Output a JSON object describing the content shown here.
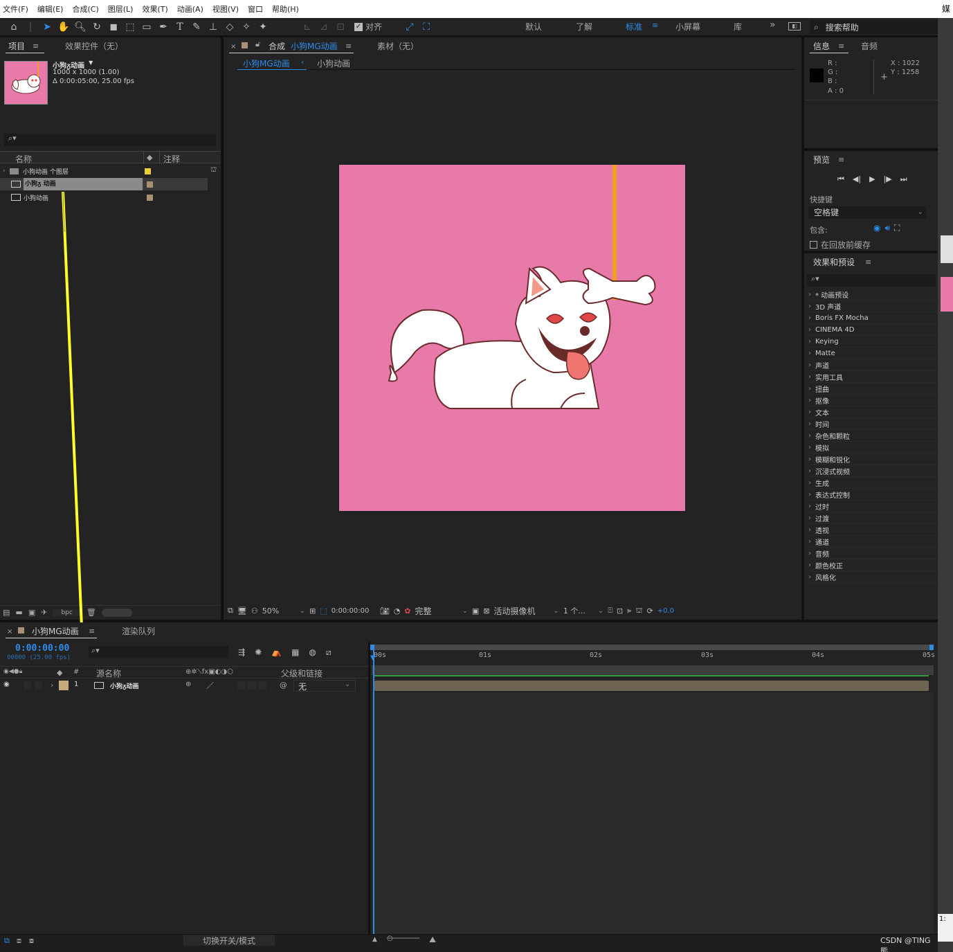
{
  "menu": [
    "文件(F)",
    "编辑(E)",
    "合成(C)",
    "图层(L)",
    "效果(T)",
    "动画(A)",
    "视图(V)",
    "窗口",
    "帮助(H)"
  ],
  "ext_top": "媒",
  "toolbar": {
    "align_label": "对齐",
    "workspaces": [
      "默认",
      "了解",
      "标准",
      "小屏幕",
      "库"
    ],
    "active_workspace": "标准",
    "more": "»",
    "search_help": "搜索帮助"
  },
  "project": {
    "tab": "项目",
    "effects_tab": "效果控件（无）",
    "selected_name": "小狗ᵹ动画",
    "dimensions": "1000 x 1000 (1.00)",
    "duration": "Δ 0:00:05:00, 25.00 fps",
    "col_name": "名称",
    "col_comment": "注释",
    "items": [
      {
        "name": "小狗动画 个图层",
        "type": "folder",
        "color": "#e8d03a"
      },
      {
        "name": "小狗ᵹ 动画",
        "type": "comp",
        "color": "#a89172",
        "selected": true
      },
      {
        "name": "小狗动画",
        "type": "comp",
        "color": "#a89172"
      }
    ],
    "bpc": "bpc"
  },
  "composition": {
    "tab_prefix": "合成",
    "tab_name": "小狗MG动画",
    "footage_tab": "素材（无）",
    "breadcrumb_active": "小狗MG动画",
    "breadcrumb_next": "小狗动画",
    "zoom": "50%",
    "timecode": "0:00:00:00",
    "resolution": "完整",
    "camera": "活动摄像机",
    "views": "1 个...",
    "exposure": "+0.0",
    "canvas_color": "#e77aa9"
  },
  "info": {
    "tab": "信息",
    "audio_tab": "音频",
    "r": "R :",
    "g": "G :",
    "b": "B :",
    "a": "A : 0",
    "x": "X : 1022",
    "y": "Y : 1258"
  },
  "preview": {
    "tab": "预览",
    "shortcut_label": "快捷键",
    "shortcut_value": "空格键",
    "include_label": "包含:",
    "cache_label": "在回放前缓存"
  },
  "effects": {
    "tab": "效果和预设",
    "items": [
      "* 动画预设",
      "3D 声道",
      "Boris FX Mocha",
      "CINEMA 4D",
      "Keying",
      "Matte",
      "声道",
      "实用工具",
      "扭曲",
      "抠像",
      "文本",
      "时间",
      "杂色和颗粒",
      "模拟",
      "模糊和锐化",
      "沉浸式视频",
      "生成",
      "表达式控制",
      "过时",
      "过渡",
      "透视",
      "通道",
      "音频",
      "颜色校正",
      "风格化"
    ]
  },
  "timeline": {
    "tab": "小狗MG动画",
    "render_tab": "渲染队列",
    "timecode": "0:00:00:00",
    "frames": "00000 (25.00 fps)",
    "col_num": "#",
    "col_source": "源名称",
    "col_parent": "父级和链接",
    "layer": {
      "num": "1",
      "name": "小狗ᵹ动画",
      "parent": "无",
      "color": "#c8a97a"
    },
    "ruler": [
      "00s",
      "01s",
      "02s",
      "03s",
      "04s",
      "05s"
    ],
    "toggle_label": "切换开关/模式"
  },
  "watermark": "CSDN @TING熊",
  "ext_bottom": "1:"
}
